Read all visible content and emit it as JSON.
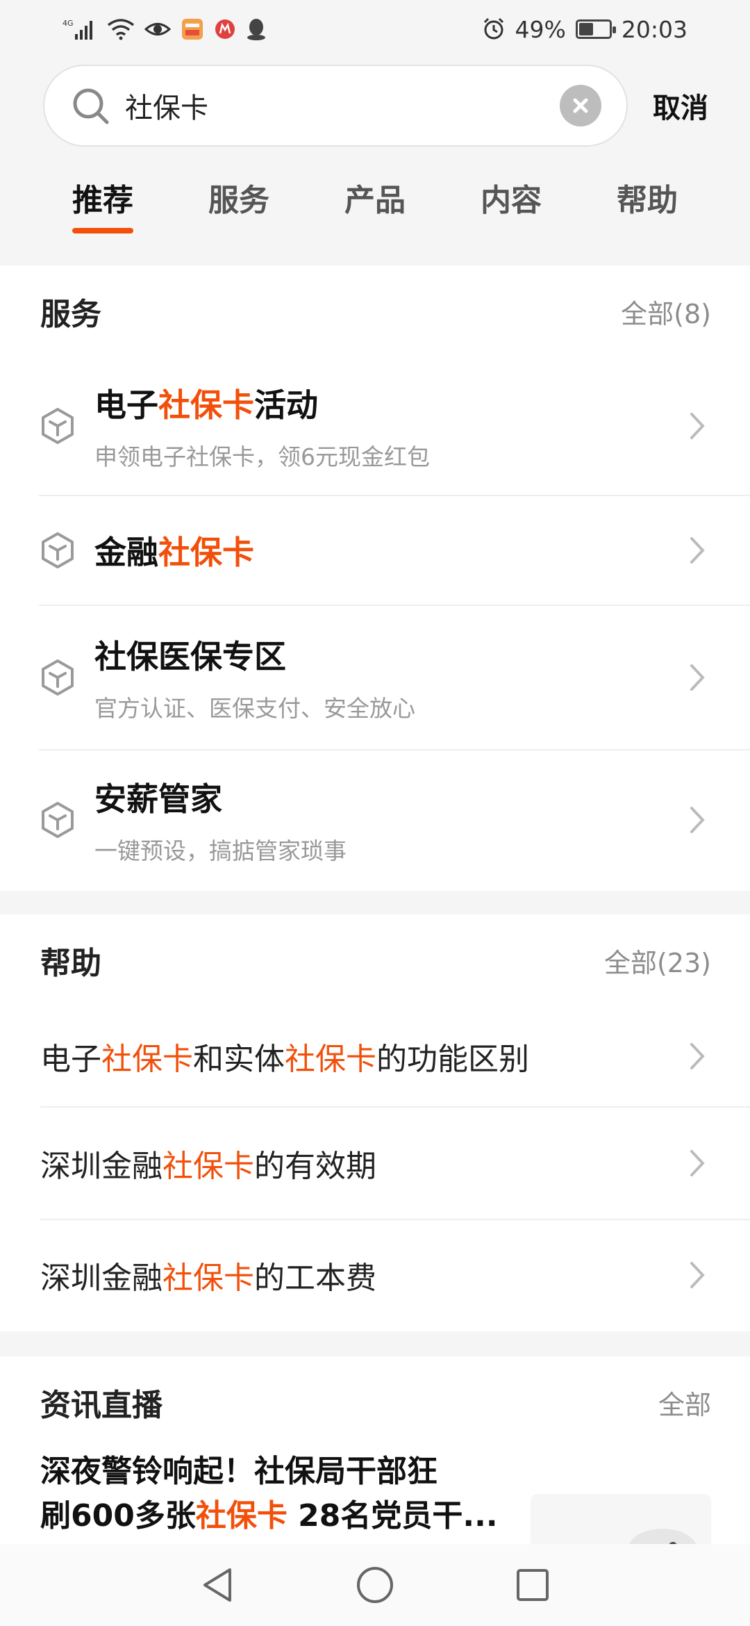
{
  "status_bar": {
    "network": "4G",
    "battery_percent": "49%",
    "battery_level": 0.49,
    "time": "20:03",
    "icons": [
      "signal-icon",
      "wifi-icon",
      "eye-icon",
      "app-notification-icon",
      "app-notification-icon-2",
      "qq-icon",
      "alarm-icon"
    ]
  },
  "search": {
    "value": "社保卡",
    "cancel_label": "取消"
  },
  "tabs": [
    {
      "label": "推荐",
      "active": true
    },
    {
      "label": "服务",
      "active": false
    },
    {
      "label": "产品",
      "active": false
    },
    {
      "label": "内容",
      "active": false
    },
    {
      "label": "帮助",
      "active": false
    }
  ],
  "services": {
    "title": "服务",
    "all_label": "全部(8)",
    "items": [
      {
        "title_pre": "电子",
        "title_hl": "社保卡",
        "title_post": "活动",
        "subtitle": "申领电子社保卡，领6元现金红包"
      },
      {
        "title_pre": "金融",
        "title_hl": "社保卡",
        "title_post": "",
        "subtitle": ""
      },
      {
        "title_pre": "社保医保专区",
        "title_hl": "",
        "title_post": "",
        "subtitle": "官方认证、医保支付、安全放心"
      },
      {
        "title_pre": "安薪管家",
        "title_hl": "",
        "title_post": "",
        "subtitle": "一键预设，搞掂管家琐事"
      }
    ]
  },
  "help": {
    "title": "帮助",
    "all_label": "全部(23)",
    "items": [
      {
        "p1": "电子",
        "h1": "社保卡",
        "p2": "和实体",
        "h2": "社保卡",
        "p3": "的功能区别"
      },
      {
        "p1": "深圳金融",
        "h1": "社保卡",
        "p2": "的有效期",
        "h2": "",
        "p3": ""
      },
      {
        "p1": "深圳金融",
        "h1": "社保卡",
        "p2": "的工本费",
        "h2": "",
        "p3": ""
      }
    ]
  },
  "news": {
    "title": "资讯直播",
    "all_label": "全部",
    "items": [
      {
        "line1": "深夜警铃响起！社保局干部狂",
        "line2_pre": "刷600多张",
        "line2_hl": "社保卡",
        "line2_post": " 28名党员干..."
      }
    ]
  },
  "colors": {
    "accent": "#f24f0a",
    "text_primary": "#111111",
    "text_secondary": "#999999",
    "background": "#f5f5f5"
  }
}
